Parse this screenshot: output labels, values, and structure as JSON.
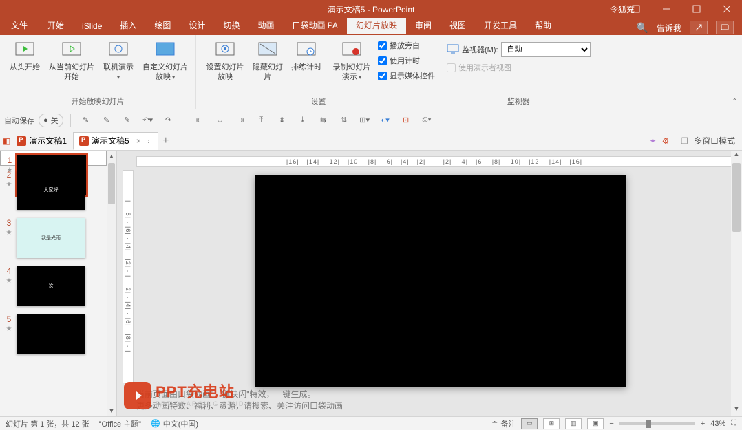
{
  "title": "演示文稿5 - PowerPoint",
  "user": "令狐充",
  "tabs": {
    "file": "文件",
    "items": [
      "开始",
      "iSlide",
      "插入",
      "绘图",
      "设计",
      "切换",
      "动画",
      "口袋动画 PA",
      "幻灯片放映",
      "审阅",
      "视图",
      "开发工具",
      "帮助"
    ],
    "active": "幻灯片放映",
    "tellme": "告诉我"
  },
  "ribbon": {
    "group1": {
      "label": "开始放映幻灯片",
      "btn1": "从头开始",
      "btn2": "从当前幻灯片开始",
      "btn3": "联机演示",
      "btn4": "自定义幻灯片放映"
    },
    "group2": {
      "label": "设置",
      "btn1": "设置幻灯片放映",
      "btn2": "隐藏幻灯片",
      "btn3": "排练计时",
      "btn4": "录制幻灯片演示",
      "chk1": "播放旁白",
      "chk2": "使用计时",
      "chk3": "显示媒体控件"
    },
    "group3": {
      "label": "监视器",
      "monitor_label": "监视器(M):",
      "monitor_value": "自动",
      "presenter": "使用演示者视图"
    }
  },
  "qat": {
    "autosave": "自动保存",
    "autosave_state": "关"
  },
  "docs": {
    "doc1": "演示文稿1",
    "doc2": "演示文稿5",
    "multi": "多窗口模式"
  },
  "ruler_h": "|16| · |14| · |12| · |10| · |8| · |6| · |4| · |2| · | · |2| · |4| · |6| · |8| · |10| · |12| · |14| · |16|",
  "ruler_v": "| · |8| · |6| · |4| · |2| · | · |2| · |4| · |6| · |8| · |",
  "thumbs": [
    {
      "n": "1",
      "txt": "",
      "white": false
    },
    {
      "n": "2",
      "txt": "大家好",
      "white": false
    },
    {
      "n": "3",
      "txt": "我是光雨",
      "white": true
    },
    {
      "n": "4",
      "txt": "这",
      "white": false
    },
    {
      "n": "5",
      "txt": "",
      "white": false
    }
  ],
  "notes": {
    "l1": "当前页面由口袋动画\"一键快闪\"特效，一键生成。",
    "l2": "更多动画特效、福利、资源，请搜索、关注访问口袋动画"
  },
  "watermark": {
    "main": "PPT充电站",
    "sub": "PPT CHARGING STUD"
  },
  "status": {
    "slide": "幻灯片 第 1 张，共 12 张",
    "theme": "\"Office 主题\"",
    "lang": "中文(中国)",
    "notes": "备注",
    "zoom": "43%"
  }
}
